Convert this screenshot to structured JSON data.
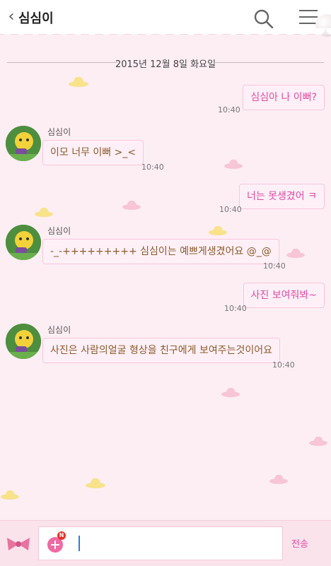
{
  "header": {
    "back_label": "‹",
    "title": "심심이"
  },
  "date_label": "2015년 12월 8일 화요일",
  "bot_name": "심심이",
  "messages": [
    {
      "from": "me",
      "text": "심심아 나 이뻐?",
      "time": "10:40"
    },
    {
      "from": "bot",
      "text": "이모 너무 이뻐 >_<",
      "time": "10:40"
    },
    {
      "from": "me",
      "text": "너는 못생겼어 ㅋ",
      "time": "10:40"
    },
    {
      "from": "bot",
      "text": "-_-+++++++++ 심심이는 예쁘게생겼어요 @_@",
      "time": "10:40"
    },
    {
      "from": "me",
      "text": "사진 보여줘봐~",
      "time": "10:40"
    },
    {
      "from": "bot",
      "text": "사진은 사람의얼굴 형상을 친구에게 보여주는것이어요",
      "time": "10:40"
    }
  ],
  "input": {
    "badge": "N",
    "value": "",
    "send_label": "전송"
  },
  "colors": {
    "background": "#fdeef4",
    "bubble_fill": "#fff0f7",
    "bubble_border": "#f6c6da",
    "my_text": "#e04aa3",
    "bot_text": "#8a5a2a",
    "input_bar": "#fbe3ec"
  }
}
